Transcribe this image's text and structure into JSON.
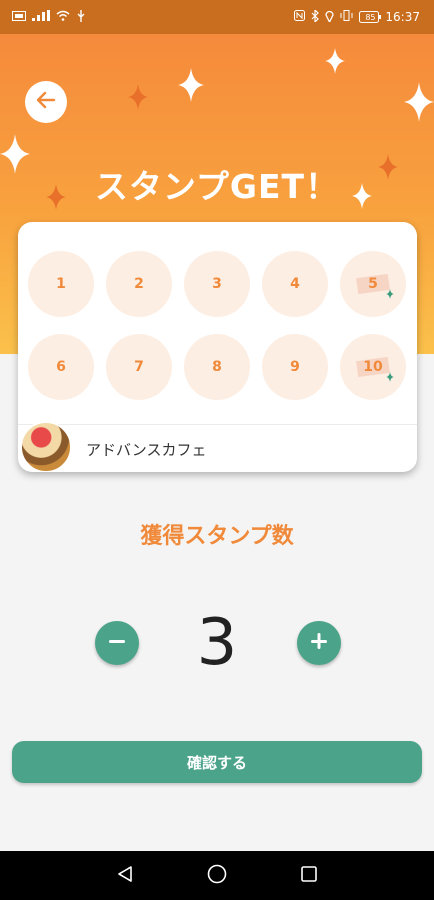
{
  "status_bar": {
    "time": "16:37",
    "battery": "85"
  },
  "header": {
    "title": "スタンプGET！"
  },
  "stamp_card": {
    "stamps": [
      {
        "label": "1",
        "bonus": false
      },
      {
        "label": "2",
        "bonus": false
      },
      {
        "label": "3",
        "bonus": false
      },
      {
        "label": "4",
        "bonus": false
      },
      {
        "label": "5",
        "bonus": true
      },
      {
        "label": "6",
        "bonus": false
      },
      {
        "label": "7",
        "bonus": false
      },
      {
        "label": "8",
        "bonus": false
      },
      {
        "label": "9",
        "bonus": false
      },
      {
        "label": "10",
        "bonus": true
      }
    ],
    "shop_name": "アドバンスカフェ"
  },
  "counter": {
    "label": "獲得スタンプ数",
    "value": "3"
  },
  "confirm_button": {
    "label": "確認する"
  },
  "colors": {
    "accent_orange": "#f08a3a",
    "button_green": "#4ba38a",
    "header_top": "#f58a3c",
    "header_bottom": "#fbc14b"
  }
}
